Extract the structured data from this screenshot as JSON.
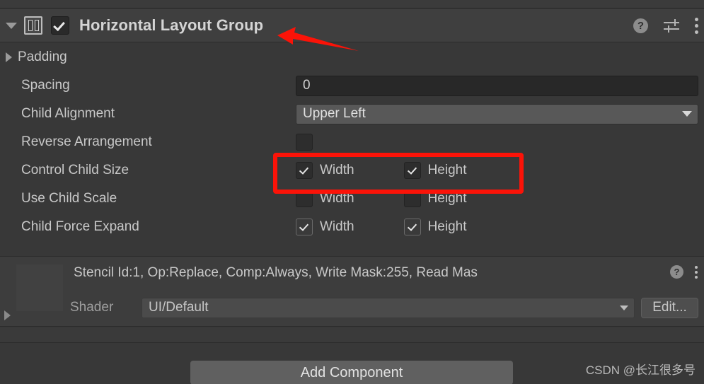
{
  "header": {
    "foldout_icon": "triangle-down-icon",
    "component_icon": "horizontal-layout-group-icon",
    "enabled": true,
    "title": "Horizontal Layout Group",
    "help_label": "?",
    "tools": {
      "help": "help-icon",
      "preset": "preset-icon",
      "menu": "kebab-menu-icon"
    }
  },
  "properties": {
    "padding": {
      "label": "Padding",
      "expanded": false
    },
    "spacing": {
      "label": "Spacing",
      "value": "0"
    },
    "child_alignment": {
      "label": "Child Alignment",
      "value": "Upper Left"
    },
    "reverse_arrangement": {
      "label": "Reverse Arrangement",
      "checked": false
    },
    "control_child_size": {
      "label": "Control Child Size",
      "width_label": "Width",
      "width_checked": true,
      "height_label": "Height",
      "height_checked": true
    },
    "use_child_scale": {
      "label": "Use Child Scale",
      "width_label": "Width",
      "width_checked": false,
      "height_label": "Height",
      "height_checked": false
    },
    "child_force_expand": {
      "label": "Child Force Expand",
      "width_label": "Width",
      "width_checked": true,
      "height_label": "Height",
      "height_checked": true
    }
  },
  "material": {
    "stencil_text": "Stencil Id:1, Op:Replace, Comp:Always, Write Mask:255, Read Mas",
    "help_label": "?",
    "shader_label": "Shader",
    "shader_value": "UI/Default",
    "edit_label": "Edit..."
  },
  "bottom": {
    "add_component_label": "Add Component",
    "watermark": "CSDN @长江很多号"
  },
  "annotations": {
    "highlight_color": "#fb1308",
    "arrow_color": "#fb1308"
  }
}
